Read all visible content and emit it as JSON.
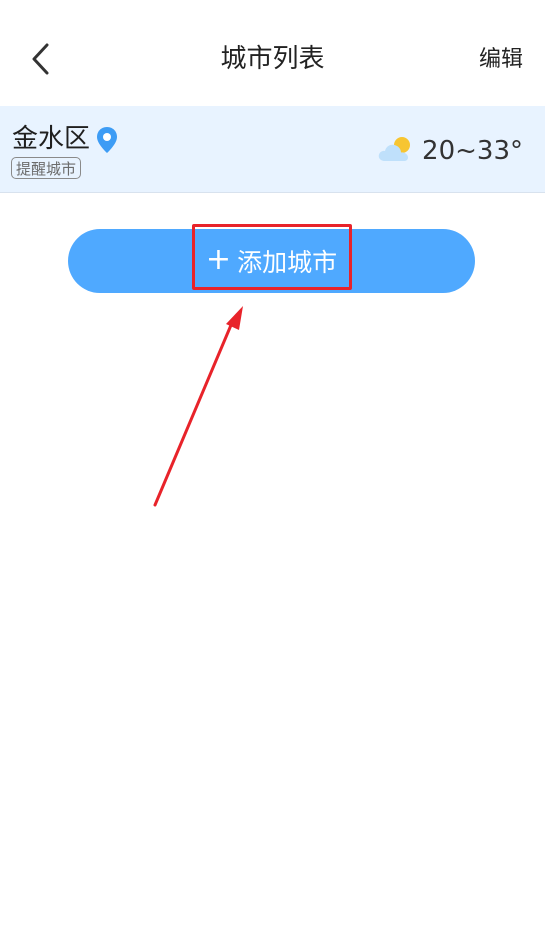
{
  "header": {
    "title": "城市列表",
    "edit_label": "编辑",
    "back_icon": "chevron-left-icon"
  },
  "city": {
    "name": "金水区",
    "location_icon": "location-pin-icon",
    "badge": "提醒城市",
    "weather_icon": "partly-cloudy-icon",
    "temperature": "20~33°"
  },
  "add_button": {
    "plus": "+",
    "label": "添加城市"
  },
  "colors": {
    "accent": "#4fa9ff",
    "city_row_bg": "#e8f3ff",
    "highlight": "#e8232a"
  }
}
